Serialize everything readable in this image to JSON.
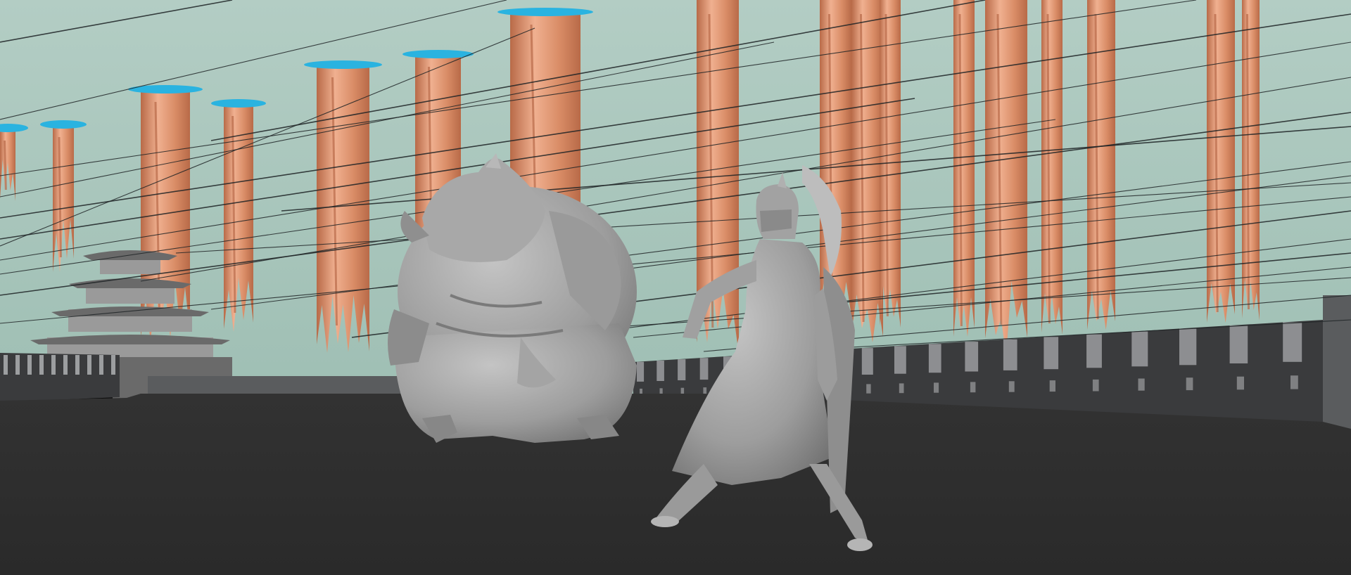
{
  "scene": {
    "colors": {
      "sky": "#9fbfb4",
      "sky_haze": "#b3cdc4",
      "floor": "#2a2a2a",
      "floor_far": "#323232",
      "wall": "#3a3b3d",
      "wall_light": "#5a5c5e",
      "merlon_highlight": "#9c9ea0",
      "pillar": "#d98c66",
      "pillar_dark": "#b86a48",
      "pillar_light": "#f0b090",
      "pillar_cap": "#2ab3e0",
      "cable": "#1f2426",
      "character": "#9d9d9d",
      "character_shadow": "#6f6f6f",
      "character_light": "#c4c4c4",
      "pagoda": "#9a9a9a",
      "pagoda_dark": "#6a6a6a"
    },
    "objects": [
      {
        "name": "sky-backdrop",
        "icon": "none"
      },
      {
        "name": "hanging-rock-pillars",
        "icon": "none"
      },
      {
        "name": "cable-lines",
        "icon": "none"
      },
      {
        "name": "pagoda-tower",
        "icon": "none"
      },
      {
        "name": "fortress-wall",
        "icon": "none"
      },
      {
        "name": "arena-floor",
        "icon": "none"
      },
      {
        "name": "ogre-character",
        "icon": "none"
      },
      {
        "name": "helmeted-warrior-character",
        "icon": "none"
      }
    ]
  }
}
